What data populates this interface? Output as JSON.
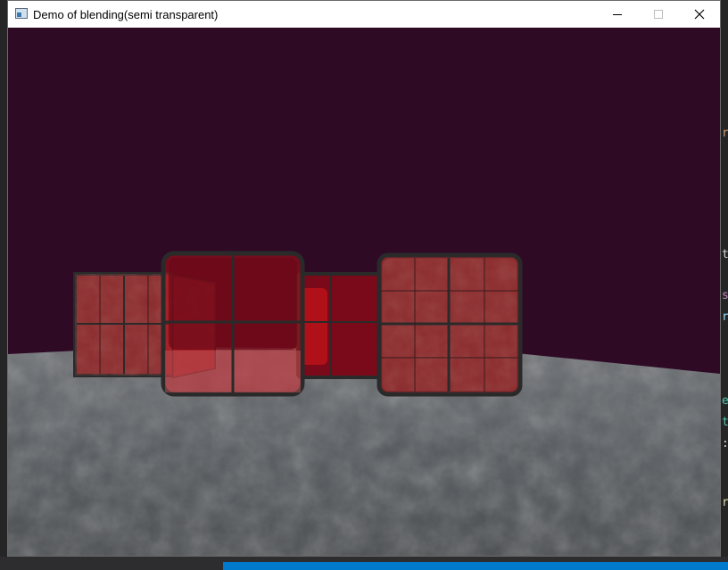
{
  "window": {
    "title": "Demo of blending(semi transparent)",
    "icon": "window-app-icon",
    "controls": {
      "minimize": "minimize-icon",
      "maximize": "maximize-icon",
      "close": "close-icon"
    }
  },
  "scene": {
    "clear_color": "#2f0a25",
    "floor_color": "#5d6166",
    "glass_color": "#b01018",
    "marble_color": "#8a2a2c",
    "frame_color": "#2a2a2a"
  },
  "background_editor": {
    "tokens": [
      "r",
      "t",
      "s",
      "r",
      "e",
      "t",
      ":",
      "ra"
    ],
    "token_colors": [
      "#d69d6e",
      "#d4d4d4",
      "#c586c0",
      "#9cdcfe",
      "#4ec9b0",
      "#4ec9b0",
      "#d4d4d4",
      "#dcdcaa"
    ]
  }
}
